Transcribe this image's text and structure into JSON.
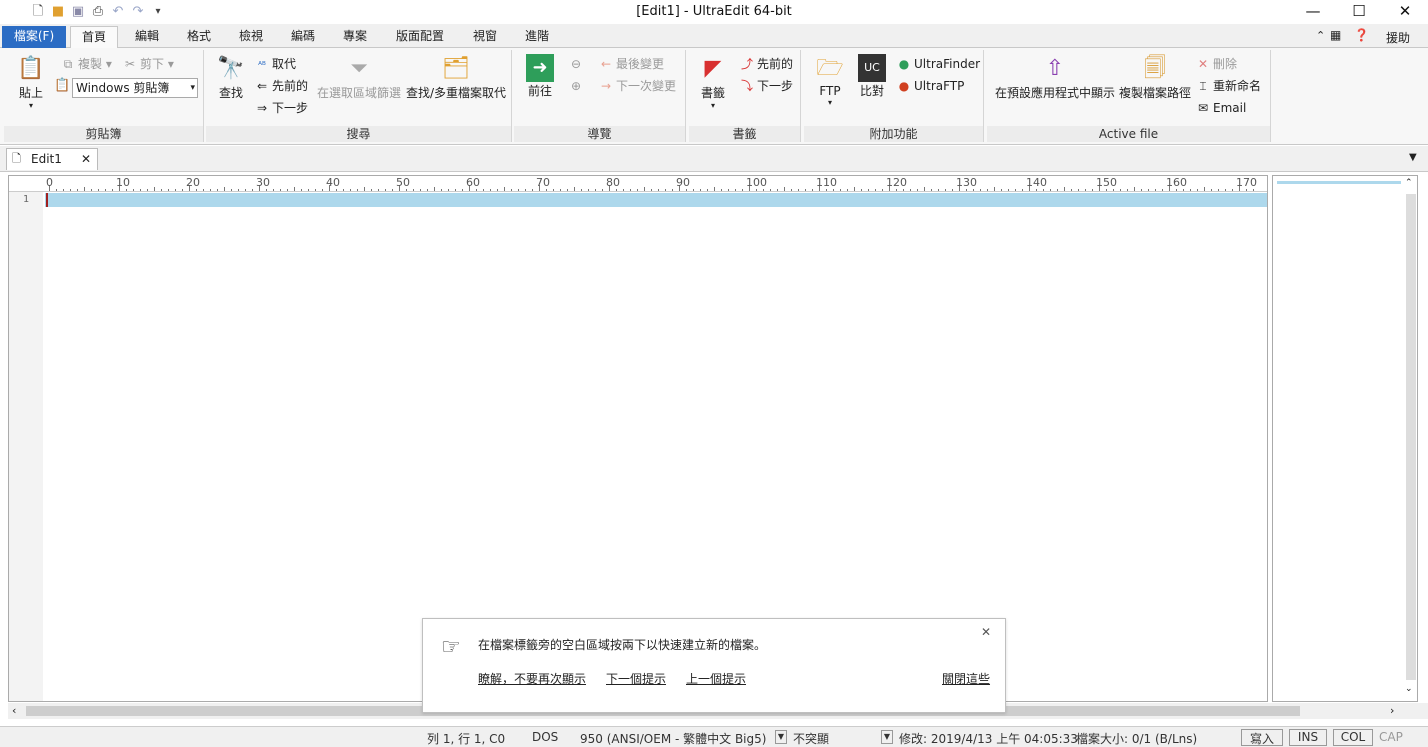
{
  "window": {
    "title": "[Edit1] - UltraEdit 64-bit"
  },
  "ribbon_tabs": [
    "檔案(F)",
    "首頁",
    "編輯",
    "格式",
    "檢視",
    "編碼",
    "專案",
    "版面配置",
    "視窗",
    "進階"
  ],
  "help_label": "援助",
  "clipboard": {
    "paste": "貼上",
    "copy": "複製",
    "cut": "剪下",
    "clipboard_select": "Windows 剪貼簿",
    "group": "剪貼簿"
  },
  "search": {
    "find": "查找",
    "replace": "取代",
    "prev": "先前的",
    "next": "下一步",
    "filter": "在選取區域篩選",
    "find_files": "查找/多重檔案取代",
    "group": "搜尋"
  },
  "navigate": {
    "goto": "前往",
    "last_change": "最後變更",
    "next_change": "下一次變更",
    "group": "導覽"
  },
  "bookmarks": {
    "bookmark": "書籤",
    "prev": "先前的",
    "next": "下一步",
    "group": "書籤"
  },
  "addons": {
    "ftp": "FTP",
    "compare": "比對",
    "finder": "UltraFinder",
    "uftp": "UltraFTP",
    "group": "附加功能"
  },
  "active_file": {
    "show_default": "在預設應用程式中顯示",
    "copy_path": "複製檔案路徑",
    "delete": "刪除",
    "rename": "重新命名",
    "email": "Email",
    "group": "Active file"
  },
  "document": {
    "tab": "Edit1",
    "line_number": "1"
  },
  "ruler_marks": [
    "0",
    "10",
    "20",
    "30",
    "40",
    "50",
    "60",
    "70",
    "80",
    "90",
    "100",
    "110",
    "120",
    "130",
    "140",
    "150",
    "160",
    "170"
  ],
  "tip": {
    "text": "在檔案標籤旁的空白區域按兩下以快速建立新的檔案。",
    "dont_show": "瞭解，不要再次顯示",
    "next": "下一個提示",
    "prev": "上一個提示",
    "close_all": "關閉這些"
  },
  "status": {
    "position": "列 1, 行 1, C0",
    "line_ending": "DOS",
    "codepage": "950  (ANSI/OEM - 繁體中文 Big5)",
    "highlight": "不突顯",
    "modified": "修改: 2019/4/13 上午 04:05:33",
    "filesize": "檔案大小: 0/1 (B/Lns)",
    "write": "寫入",
    "ins": "INS",
    "col": "COL",
    "cap": "CAP"
  }
}
